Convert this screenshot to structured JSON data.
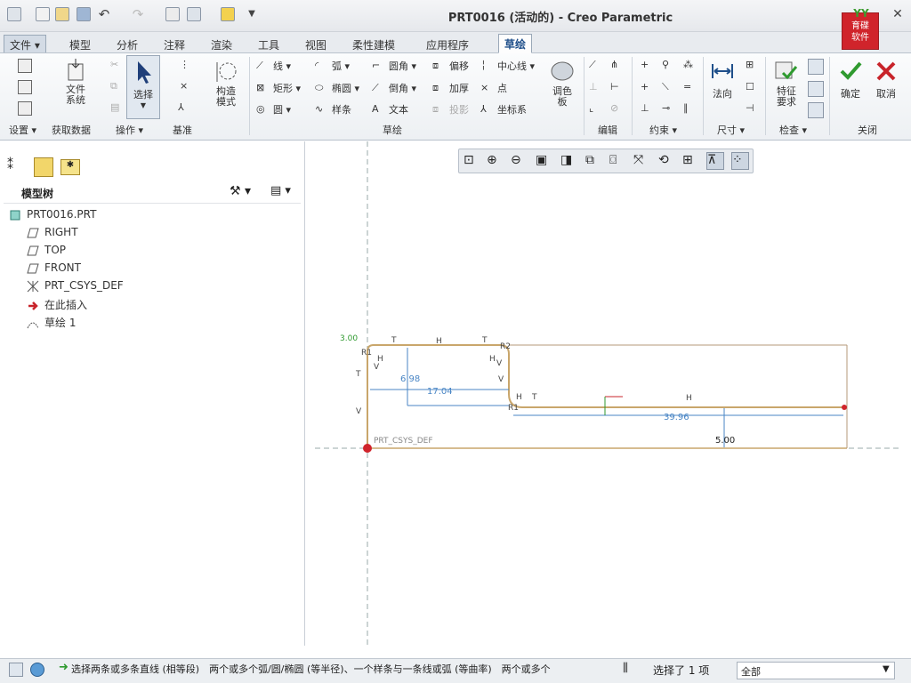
{
  "title": "PRT0016 (活动的) - Creo Parametric",
  "tabs": [
    {
      "label": "文件",
      "type": "file"
    },
    {
      "label": "模型"
    },
    {
      "label": "分析"
    },
    {
      "label": "注释"
    },
    {
      "label": "渲染"
    },
    {
      "label": "工具"
    },
    {
      "label": "视图"
    },
    {
      "label": "柔性建模"
    },
    {
      "label": "应用程序"
    },
    {
      "label": "草绘",
      "active": true
    }
  ],
  "ribbon": {
    "file_system": "文件\n系统",
    "select": "选择",
    "construction_mode": "构造\n模式",
    "line": "线",
    "rectangle": "矩形",
    "circle": "圆",
    "arc": "弧",
    "ellipse": "椭圆",
    "spline": "样条",
    "fillet": "圆角",
    "chamfer": "倒角",
    "text": "文本",
    "offset": "偏移",
    "thicken": "加厚",
    "project": "投影",
    "centerline": "中心线",
    "point": "点",
    "coord_sys": "坐标系",
    "palette": "调色\n板",
    "normal": "法向",
    "feature_requirements": "特征\n要求",
    "ok": "确定",
    "cancel": "取消",
    "groups": {
      "setup": "设置",
      "get_data": "获取数据",
      "operations": "操作",
      "datum": "基准",
      "sketching": "草绘",
      "editing": "编辑",
      "constrain": "约束",
      "dimension": "尺寸",
      "inspect": "检查",
      "close": "关闭"
    }
  },
  "logo": {
    "top": "YY",
    "text": "育碟\n软件"
  },
  "model_tree": {
    "header": "模型树",
    "items": [
      {
        "label": "PRT0016.PRT",
        "icon": "part-icon"
      },
      {
        "label": "RIGHT",
        "icon": "datum-plane-icon"
      },
      {
        "label": "TOP",
        "icon": "datum-plane-icon"
      },
      {
        "label": "FRONT",
        "icon": "datum-plane-icon"
      },
      {
        "label": "PRT_CSYS_DEF",
        "icon": "csys-icon"
      },
      {
        "label": "在此插入",
        "icon": "insert-here-icon"
      },
      {
        "label": "草绘 1",
        "icon": "sketch-icon"
      }
    ]
  },
  "sketch": {
    "dims": [
      "3.00",
      "6.98",
      "17.04",
      "39.96",
      "5.00"
    ],
    "csys_label": "PRT_CSYS_DEF",
    "constraints": [
      "R1",
      "H",
      "V",
      "T",
      "H",
      "T",
      "R2",
      "H",
      "V",
      "T",
      "V",
      "V",
      "H",
      "T",
      "R1",
      "H"
    ]
  },
  "status": {
    "message": "选择两条或多条直线 (相等段)　两个或多个弧/圆/椭圆 (等半径)、一个样条与一条线或弧 (等曲率)　两个或多个",
    "selected": "选择了 1 项",
    "filter": "全部"
  },
  "colors": {
    "sketch_entity": "#c9a66b",
    "dimension": "#4a86c5",
    "csys": "#d0242b",
    "accent_tab": "#1f4f8a",
    "ok_green": "#2f9a2f",
    "cancel_red": "#c8242b"
  }
}
